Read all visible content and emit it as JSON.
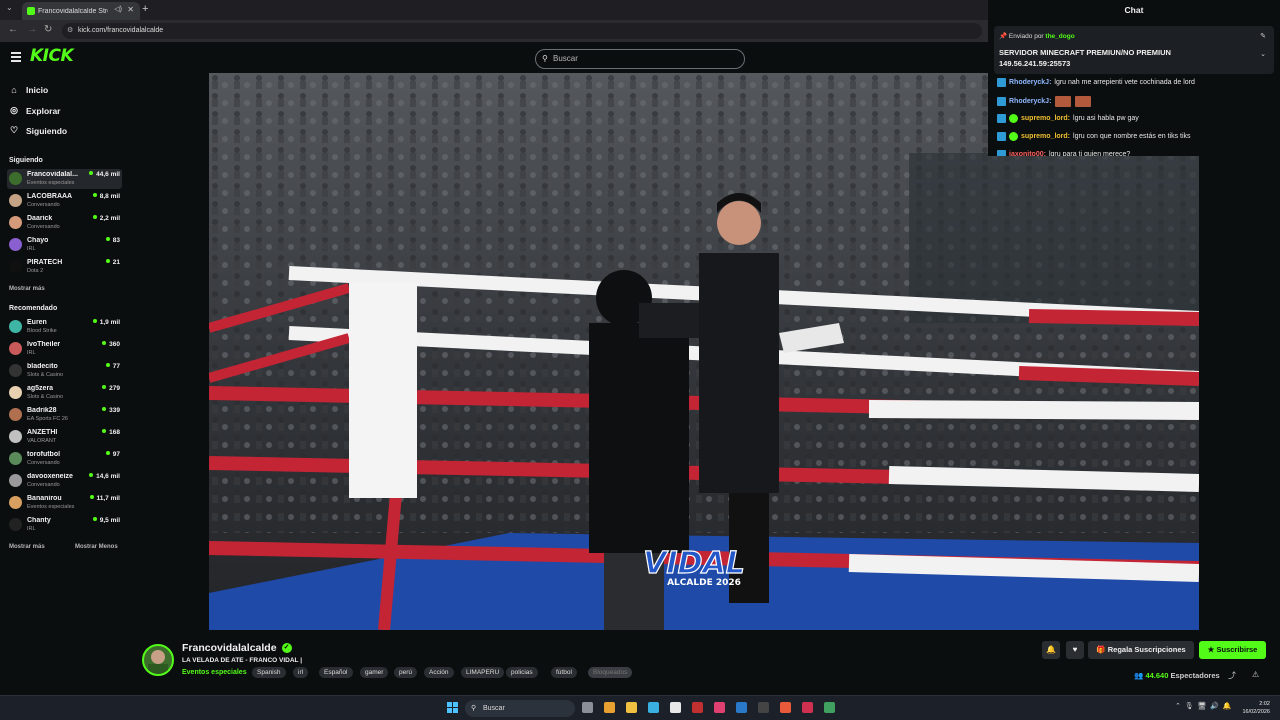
{
  "browser": {
    "tab_title": "Francovidalalcalde Stream",
    "url": "kick.com/francovidalalcalde",
    "new_tab": "+"
  },
  "header": {
    "logo": "KICK",
    "search_placeholder": "Buscar"
  },
  "sidebar": {
    "nav": [
      {
        "label": "Inicio",
        "icon": "home-icon"
      },
      {
        "label": "Explorar",
        "icon": "compass-icon"
      },
      {
        "label": "Siguiendo",
        "icon": "heart-icon"
      }
    ],
    "following_title": "Siguiendo",
    "following": [
      {
        "name": "Francovidalal...",
        "category": "Eventos especiales",
        "viewers": "44,6 mil",
        "color": "#3d6d2c"
      },
      {
        "name": "LACOBRAAA",
        "category": "Conversando",
        "viewers": "8,8 mil",
        "color": "#c4a484"
      },
      {
        "name": "Daarick",
        "category": "Conversando",
        "viewers": "2,2 mil",
        "color": "#d49a7a"
      },
      {
        "name": "Chayo",
        "category": "IRL",
        "viewers": "83",
        "color": "#8a5fd0"
      },
      {
        "name": "PIRATECH",
        "category": "Dota 2",
        "viewers": "21",
        "color": "#101010"
      }
    ],
    "show_more_following": "Mostrar más",
    "recommended_title": "Recomendado",
    "recommended": [
      {
        "name": "Euren",
        "category": "Blood Strike",
        "viewers": "1,9 mil",
        "color": "#3fb5a5"
      },
      {
        "name": "IvoTheiler",
        "category": "IRL",
        "viewers": "360",
        "color": "#c85a5a"
      },
      {
        "name": "bladecito",
        "category": "Slots & Casino",
        "viewers": "77",
        "color": "#333333"
      },
      {
        "name": "ag5zera",
        "category": "Slots & Casino",
        "viewers": "279",
        "color": "#e8d0b0"
      },
      {
        "name": "Badrik28",
        "category": "EA Sports FC 26",
        "viewers": "339",
        "color": "#b07050"
      },
      {
        "name": "ANZETHI",
        "category": "VALORANT",
        "viewers": "168",
        "color": "#c0c0c0"
      },
      {
        "name": "torofutbol",
        "category": "Conversando",
        "viewers": "97",
        "color": "#5a8a5a"
      },
      {
        "name": "davooxeneize",
        "category": "Conversando",
        "viewers": "14,6 mil",
        "color": "#9a9a9a"
      },
      {
        "name": "Bananirou",
        "category": "Eventos especiales",
        "viewers": "11,7 mil",
        "color": "#d8a060"
      },
      {
        "name": "Chanty",
        "category": "IRL",
        "viewers": "9,5 mil",
        "color": "#222222"
      }
    ],
    "show_more": "Mostrar más",
    "show_less": "Mostrar Menos"
  },
  "chat": {
    "title": "Chat",
    "pinned": {
      "sent_by": "Enviado por",
      "user": "the_dogo",
      "text": "SERVIDOR MINECRAFT PREMIUN/NO PREMIUN 149.56.241.59:25573"
    },
    "messages": [
      {
        "user": "RhoderyckJ:",
        "text": " lgru nah me arrepienti vete cochinada de lord",
        "color": "#8fb8ff",
        "badge2": false,
        "emotes": false
      },
      {
        "user": "RhoderyckJ:",
        "text": "",
        "color": "#8fb8ff",
        "badge2": false,
        "emotes": true
      },
      {
        "user": "supremo_lord:",
        "text": " lgru asi habla pw gay",
        "color": "#f0c030",
        "badge2": true,
        "emotes": false
      },
      {
        "user": "supremo_lord:",
        "text": " lgru con que nombre estás en tiks tiks",
        "color": "#f0c030",
        "badge2": true,
        "emotes": false
      },
      {
        "user": "jaxonito00:",
        "text": " lgru para ti quien merece?",
        "color": "#ff6060",
        "badge2": false,
        "emotes": false
      }
    ]
  },
  "video": {
    "overlay_top": "VIDAL",
    "overlay_bottom": "ALCALDE 2026"
  },
  "stream": {
    "streamer": "Francovidalalcalde",
    "title": "LA VELADA DE ATE - FRANCO VIDAL |",
    "category": "Eventos especiales",
    "tags": [
      "Spanish",
      "irl",
      "Español",
      "gamer",
      "perú",
      "Acción",
      "LIMAPERU",
      "policias",
      "fútbol",
      "Bloqueados"
    ],
    "gift_label": "Regala Suscripciones",
    "subscribe_label": "Suscribirse",
    "viewers_count": "44.640",
    "viewers_label": "Espectadores"
  },
  "taskbar": {
    "search_label": "Buscar",
    "time": "2:02",
    "date": "16/02/2026",
    "icons": [
      "#8a8f98",
      "#e8a030",
      "#f0c040",
      "#3ab0e0",
      "#e8e8e8",
      "#c03030",
      "#e04070",
      "#2a78c8",
      "#444444",
      "#e85a3a",
      "#d03050",
      "#40a060"
    ]
  },
  "colors": {
    "accent": "#53fc18",
    "background": "#0b0e0f"
  }
}
